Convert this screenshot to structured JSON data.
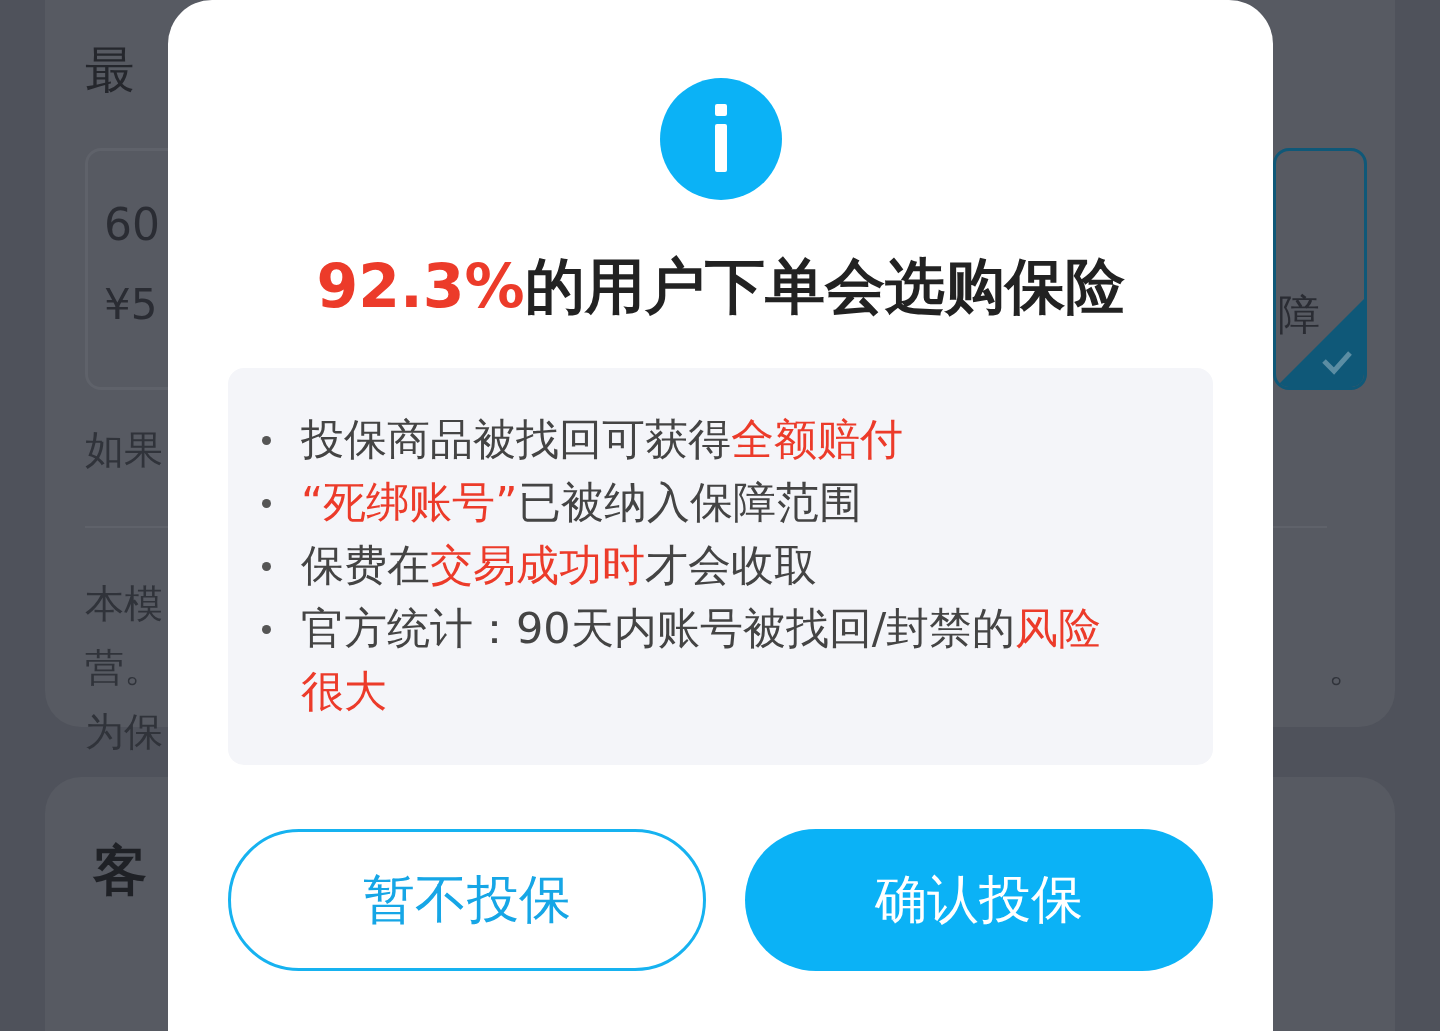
{
  "background": {
    "heading": "最",
    "options": [
      {
        "line_1": "60",
        "line_2": "¥5",
        "selected": false
      },
      {
        "line_2": "障",
        "selected": true
      }
    ],
    "note": "如果",
    "paragraph": [
      {
        "left": "本模"
      },
      {
        "left": "营。",
        "right": "。"
      },
      {
        "left": "为保"
      }
    ],
    "section_heading": "客"
  },
  "dialog": {
    "title_highlight": "92.3%",
    "title_rest": "的用户下单会选购保险",
    "bullets": [
      [
        {
          "text": "投保商品被找回可获得",
          "highlight": false
        },
        {
          "text": "全额赔付",
          "highlight": true
        }
      ],
      [
        {
          "text": "“死绑账号”",
          "highlight": true
        },
        {
          "text": "已被纳入保障范围",
          "highlight": false
        }
      ],
      [
        {
          "text": "保费在",
          "highlight": false
        },
        {
          "text": "交易成功时",
          "highlight": true
        },
        {
          "text": "才会收取",
          "highlight": false
        }
      ],
      [
        {
          "text": "官方统计：90天内账号被找回/封禁的",
          "highlight": false
        },
        {
          "text": "风险很大",
          "highlight": true
        }
      ]
    ],
    "buttons": [
      {
        "label": "暂不投保",
        "kind": "outline"
      },
      {
        "label": "确认投保",
        "kind": "primary"
      }
    ]
  }
}
